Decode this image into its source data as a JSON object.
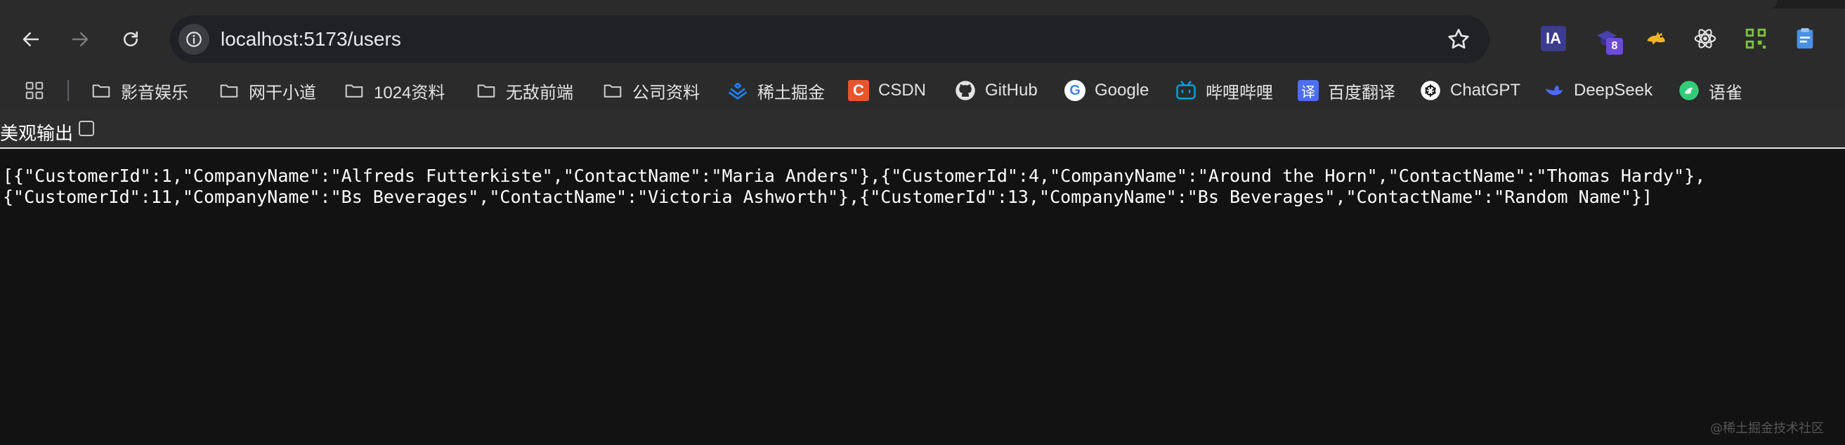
{
  "browser": {
    "address_bar": {
      "url": "localhost:5173/users"
    },
    "extensions": [
      {
        "name": "ia-icon",
        "label": "IA"
      },
      {
        "name": "graduation-cap-icon",
        "badge": "8"
      },
      {
        "name": "cat-icon"
      },
      {
        "name": "react-icon"
      },
      {
        "name": "qr-code-icon"
      },
      {
        "name": "clipboard-icon"
      }
    ]
  },
  "bookmarks": [
    {
      "label": "影音娱乐",
      "icon": "folder-icon"
    },
    {
      "label": "网干小道",
      "icon": "folder-icon"
    },
    {
      "label": "1024资料",
      "icon": "folder-icon"
    },
    {
      "label": "无敌前端",
      "icon": "folder-icon"
    },
    {
      "label": "公司资料",
      "icon": "folder-icon"
    },
    {
      "label": "稀土掘金",
      "icon": "juejin-icon"
    },
    {
      "label": "CSDN",
      "icon": "csdn-icon"
    },
    {
      "label": "GitHub",
      "icon": "github-icon"
    },
    {
      "label": "Google",
      "icon": "google-icon"
    },
    {
      "label": "哔哩哔哩",
      "icon": "bilibili-icon"
    },
    {
      "label": "百度翻译",
      "icon": "translate-icon"
    },
    {
      "label": "ChatGPT",
      "icon": "chatgpt-icon"
    },
    {
      "label": "DeepSeek",
      "icon": "deepseek-icon"
    },
    {
      "label": "语雀",
      "icon": "yuque-icon"
    }
  ],
  "page": {
    "pretty_print_label": "美观输出",
    "json_lines": [
      "[{\"CustomerId\":1,\"CompanyName\":\"Alfreds Futterkiste\",\"ContactName\":\"Maria Anders\"},{\"CustomerId\":4,\"CompanyName\":\"Around the Horn\",\"ContactName\":\"Thomas Hardy\"},",
      "{\"CustomerId\":11,\"CompanyName\":\"Bs Beverages\",\"ContactName\":\"Victoria Ashworth\"},{\"CustomerId\":13,\"CompanyName\":\"Bs Beverages\",\"ContactName\":\"Random Name\"}]"
    ],
    "watermark": "@稀土掘金技术社区"
  },
  "colors": {
    "toolbar": "#2b2b2b",
    "omnibox": "#202124",
    "page_background": "#121212",
    "accent_blue": "#1e80ff"
  }
}
